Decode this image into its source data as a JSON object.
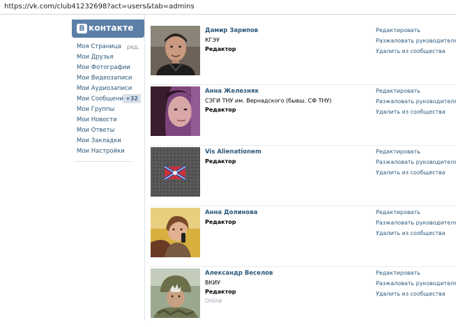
{
  "browser": {
    "url": "https://vk.com/club41232698?act=users&tab=admins"
  },
  "logo": {
    "icon_letter": "В",
    "text": "контакте"
  },
  "menu": [
    {
      "label": "Моя Страница",
      "extra": "ред."
    },
    {
      "label": "Мои Друзья"
    },
    {
      "label": "Мои Фотографии"
    },
    {
      "label": "Мои Видеозаписи"
    },
    {
      "label": "Мои Аудиозаписи"
    },
    {
      "label": "Мои Сообщения",
      "badge": "+32"
    },
    {
      "label": "Мои Группы"
    },
    {
      "label": "Мои Новости"
    },
    {
      "label": "Мои Ответы"
    },
    {
      "label": "Мои Закладки"
    },
    {
      "label": "Мои Настройки"
    }
  ],
  "admins": [
    {
      "name": "Дамир Зарипов",
      "subtitle": "КГЭУ",
      "role": "Редактор",
      "status": ""
    },
    {
      "name": "Анна Железняк",
      "subtitle": "СЭГИ ТНУ им. Вернадского (бывш. СФ ТНУ)",
      "role": "Редактор",
      "status": ""
    },
    {
      "name": "Vis Alienationem",
      "subtitle": "",
      "role": "Редактор",
      "status": ""
    },
    {
      "name": "Анна Долинова",
      "subtitle": "",
      "role": "Редактор",
      "status": ""
    },
    {
      "name": "Александр Веселов",
      "subtitle": "ВКИУ",
      "role": "Редактор",
      "status": "Online"
    }
  ],
  "actions": {
    "edit": "Редактировать",
    "demote": "Разжаловать руководителя",
    "remove": "Удалить из сообщества"
  },
  "colors": {
    "link": "#2b587a",
    "header": "#5b7fa6",
    "badge_bg": "#dae1e8"
  }
}
